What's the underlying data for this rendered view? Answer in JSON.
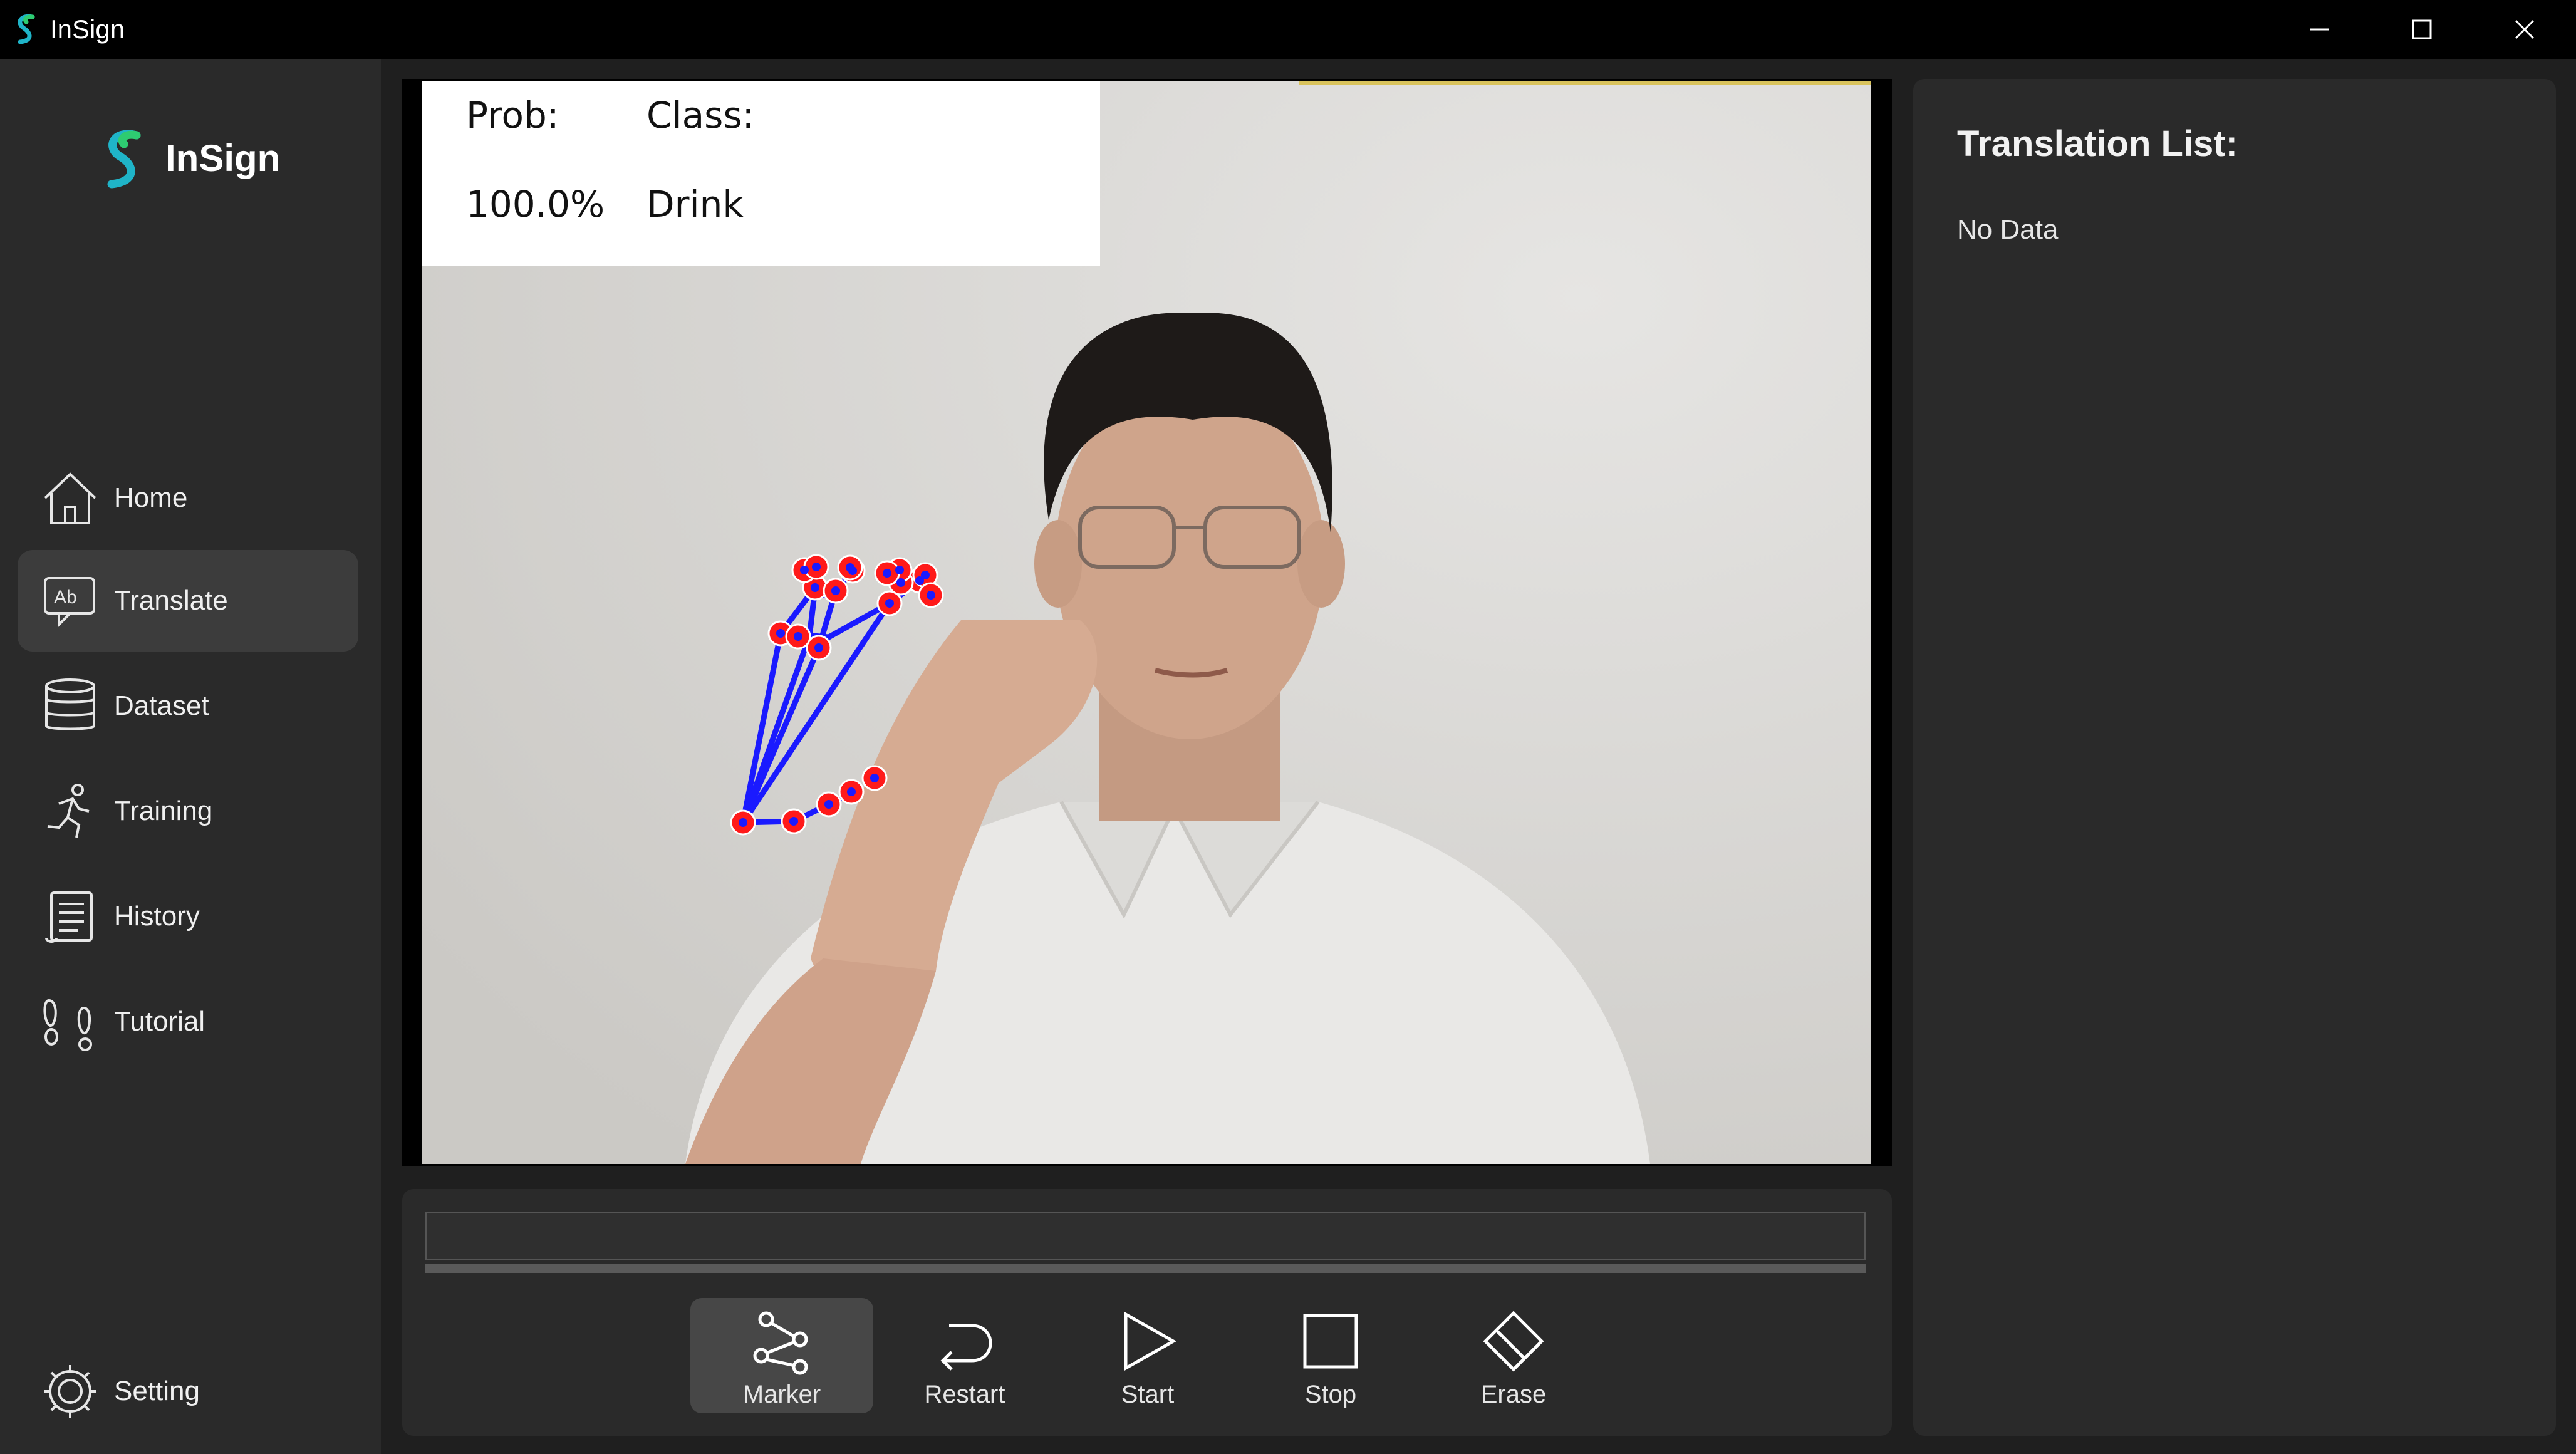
{
  "window": {
    "title": "InSign"
  },
  "brand": {
    "name": "InSign",
    "accent": "#1fb4c8",
    "accent2": "#2ecc71"
  },
  "sidebar": {
    "items": [
      {
        "label": "Home",
        "icon": "home-icon"
      },
      {
        "label": "Translate",
        "icon": "translate-icon",
        "active": true
      },
      {
        "label": "Dataset",
        "icon": "database-icon"
      },
      {
        "label": "Training",
        "icon": "running-icon"
      },
      {
        "label": "History",
        "icon": "scroll-icon"
      },
      {
        "label": "Tutorial",
        "icon": "footprints-icon"
      }
    ],
    "setting": {
      "label": "Setting",
      "icon": "gear-icon"
    }
  },
  "prediction": {
    "prob_label": "Prob:",
    "class_label": "Class:",
    "prob_value": "100.0%",
    "class_value": "Drink"
  },
  "controls": {
    "input_value": "",
    "buttons": [
      {
        "label": "Marker",
        "icon": "marker-nodes-icon",
        "active": true
      },
      {
        "label": "Restart",
        "icon": "restart-icon"
      },
      {
        "label": "Start",
        "icon": "play-icon"
      },
      {
        "label": "Stop",
        "icon": "stop-icon"
      },
      {
        "label": "Erase",
        "icon": "eraser-icon"
      }
    ]
  },
  "translation": {
    "title": "Translation List:",
    "empty_text": "No Data"
  },
  "colors": {
    "background": "#1f1f1f",
    "panel": "#2a2a2a",
    "active_nav": "#3c3c3c",
    "landmark_line": "#1a1aff",
    "landmark_point": "#ff1a1a"
  }
}
